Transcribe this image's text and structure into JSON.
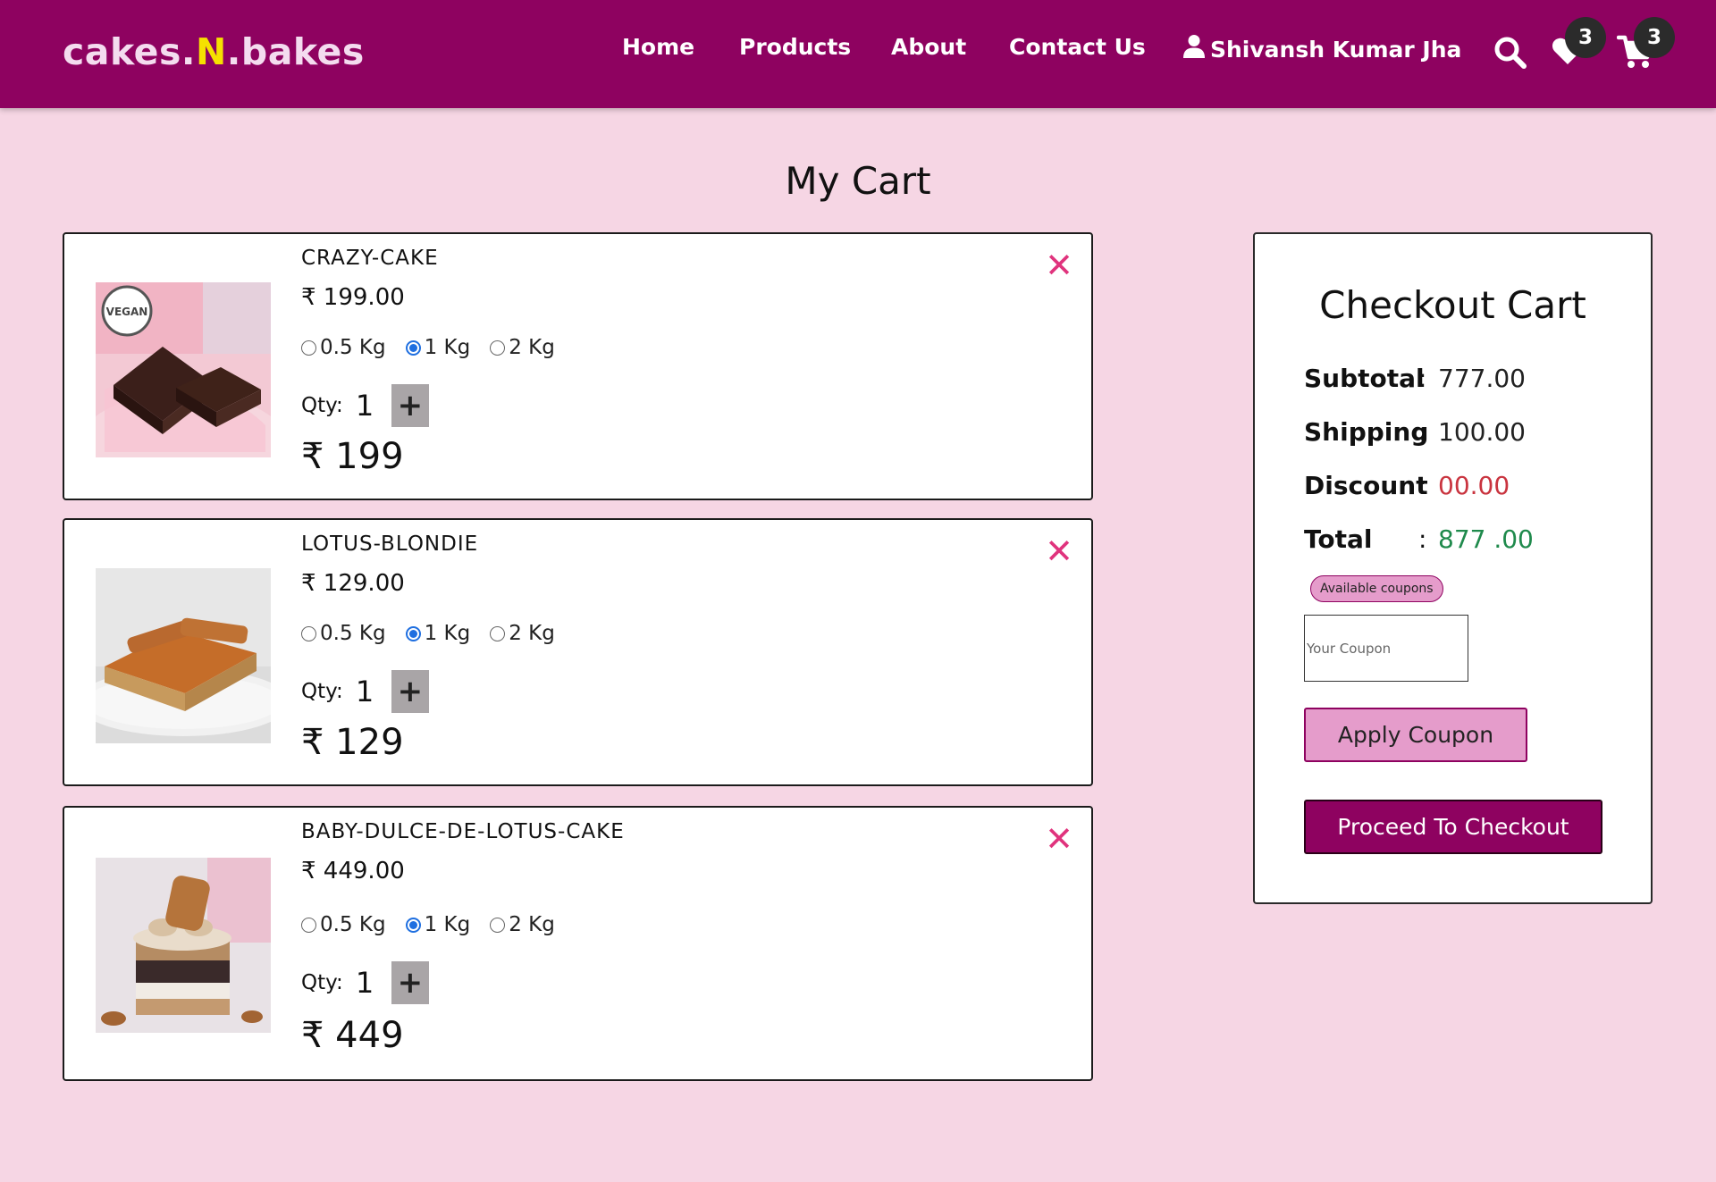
{
  "header": {
    "brand_part1": "cakes.",
    "brand_part2": "N",
    "brand_part3": ".bakes",
    "nav": [
      "Home",
      "Products",
      "About",
      "Contact Us"
    ],
    "user_name": "Shivansh Kumar Jha",
    "wishlist_count": "3",
    "cart_count": "3",
    "colors": {
      "bar": "#8e0260",
      "brand_accent": "#f5e100"
    }
  },
  "page": {
    "title": "My Cart"
  },
  "cart": {
    "qty_label": "Qty:",
    "weights": [
      "0.5 Kg",
      "1 Kg",
      "2 Kg"
    ],
    "plus_label": "+",
    "remove_label": "✕",
    "items": [
      {
        "name": "CRAZY-CAKE",
        "price": "₹ 199.00",
        "selected_weight": "1 Kg",
        "qty": "1",
        "total": "₹ 199",
        "image": "chocolate-brownie-vegan"
      },
      {
        "name": "LOTUS-BLONDIE",
        "price": "₹ 129.00",
        "selected_weight": "1 Kg",
        "qty": "1",
        "total": "₹ 129",
        "image": "lotus-blondie-slice"
      },
      {
        "name": "BABY-DULCE-DE-LOTUS-CAKE",
        "price": "₹ 449.00",
        "selected_weight": "1 Kg",
        "qty": "1",
        "total": "₹ 449",
        "image": "lotus-layer-cake"
      }
    ]
  },
  "checkout": {
    "title": "Checkout Cart",
    "subtotal_label": "Subtotal",
    "subtotal": "777.00",
    "shipping_label": "Shipping",
    "shipping": "100.00",
    "discount_label": "Discount",
    "discount": "00.00",
    "total_label": "Total",
    "total": "877 .00",
    "colon": ":",
    "coupons_label": "Available coupons",
    "coupon_placeholder": "Your Coupon",
    "apply_label": "Apply Coupon",
    "proceed_label": "Proceed To Checkout",
    "colors": {
      "discount": "#c9343f",
      "total": "#1f8a4c"
    }
  }
}
